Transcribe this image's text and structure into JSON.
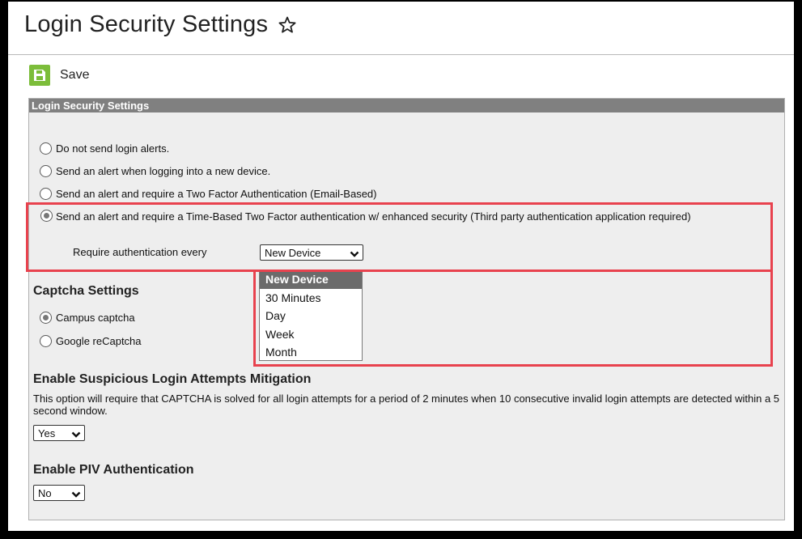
{
  "page": {
    "title": "Login Security Settings"
  },
  "toolbar": {
    "save_label": "Save"
  },
  "panel": {
    "header": "Login Security Settings",
    "alert_options": [
      {
        "label": "Do not send login alerts.",
        "checked": false
      },
      {
        "label": "Send an alert when logging into a new device.",
        "checked": false
      },
      {
        "label": "Send an alert and require a Two Factor Authentication (Email-Based)",
        "checked": false
      },
      {
        "label": "Send an alert and require a Time-Based Two Factor authentication w/ enhanced security (Third party authentication application required)",
        "checked": true
      }
    ],
    "require_auth_label": "Require authentication every",
    "require_auth_value": "New Device",
    "require_auth_options": [
      "New Device",
      "30 Minutes",
      "Day",
      "Week",
      "Month"
    ],
    "captcha": {
      "title": "Captcha Settings",
      "options": [
        {
          "label": "Campus captcha",
          "checked": true
        },
        {
          "label": "Google reCaptcha",
          "checked": false
        }
      ]
    },
    "suspicious": {
      "title": "Enable Suspicious Login Attempts Mitigation",
      "description": "This option will require that CAPTCHA is solved for all login attempts for a period of 2 minutes when 10 consecutive invalid login attempts are detected within a 5 second window.",
      "value": "Yes"
    },
    "piv": {
      "title": "Enable PIV Authentication",
      "value": "No"
    }
  },
  "colors": {
    "save_icon_bg": "#7cbd3a",
    "panel_header_bg": "#808080",
    "panel_bg": "#eeeeee",
    "highlight": "#e8424e",
    "dropdown_selected_bg": "#6b6b6b"
  },
  "icons": {
    "favorite": "star-outline-icon",
    "save": "floppy-disk-icon",
    "select_arrow": "chevron-down-icon"
  }
}
